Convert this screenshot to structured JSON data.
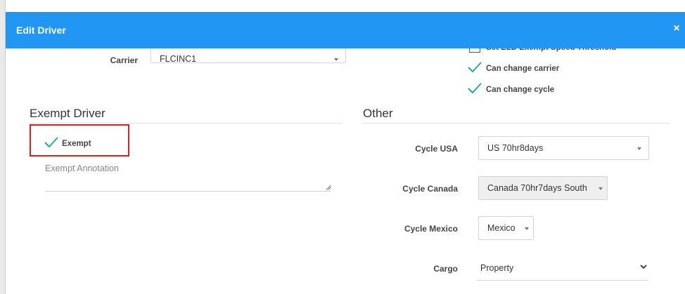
{
  "dialog": {
    "title": "Edit Driver",
    "close_symbol": "×",
    "header_color": "#2196f3"
  },
  "carrier": {
    "label": "Carrier",
    "value": "FLCINC1"
  },
  "permissions": [
    {
      "label": "Set ELD Exempt Speed Threshold",
      "checked": false
    },
    {
      "label": "Can change carrier",
      "checked": true
    },
    {
      "label": "Can change cycle",
      "checked": true
    }
  ],
  "exempt_section": {
    "title": "Exempt Driver",
    "exempt_label": "Exempt",
    "exempt_checked": true,
    "annotation_placeholder": "Exempt Annotation"
  },
  "other_section": {
    "title": "Other",
    "cycle_usa": {
      "label": "Cycle USA",
      "value": "US 70hr8days"
    },
    "cycle_canada": {
      "label": "Cycle Canada",
      "value": "Canada 70hr7days South"
    },
    "cycle_mexico": {
      "label": "Cycle Mexico",
      "value": "Mexico"
    },
    "cargo": {
      "label": "Cargo",
      "value": "Property"
    }
  },
  "colors": {
    "check": "#26a69a",
    "highlight": "#e02020"
  }
}
